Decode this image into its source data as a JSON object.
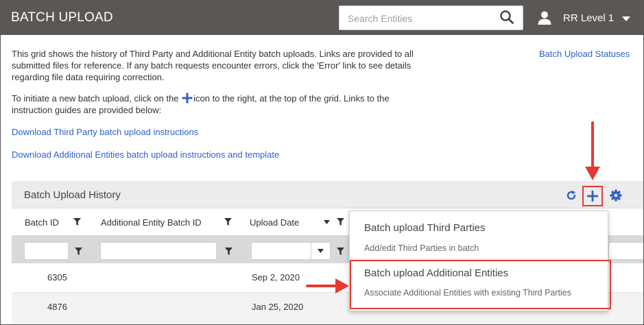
{
  "header": {
    "title": "BATCH UPLOAD",
    "search_placeholder": "Search Entities",
    "user_name": "RR Level 1"
  },
  "intro": {
    "paragraph1": "This grid shows the history of Third Party and Additional Entity batch uploads. Links are provided to all submitted files for reference. If any batch requests encounter errors, click the 'Error' link to see details regarding file data requiring correction.",
    "paragraph2_before": "To initiate a new batch upload, click on the",
    "paragraph2_after": "icon to the right, at the top of the grid. Links to the instruction guides are provided below:"
  },
  "links": {
    "statuses": "Batch Upload Statuses",
    "third_party_instructions": "Download Third Party batch upload instructions",
    "additional_entities_instructions": "Download Additional Entities batch upload instructions and template"
  },
  "grid": {
    "title": "Batch Upload History",
    "columns": [
      {
        "label": "Batch ID"
      },
      {
        "label": "Additional Entity Batch ID"
      },
      {
        "label": "Upload Date"
      }
    ],
    "rows": [
      {
        "batch_id": "6305",
        "ae_batch_id": "",
        "upload_date": "Sep 2, 2020"
      },
      {
        "batch_id": "4876",
        "ae_batch_id": "",
        "upload_date": "Jan 25, 2020"
      }
    ]
  },
  "dropdown": {
    "items": [
      {
        "title": "Batch upload Third Parties",
        "subtitle": "Add/edit Third Parties in batch"
      },
      {
        "title": "Batch upload Additional Entities",
        "subtitle": "Associate Additional Entities with existing Third Parties"
      }
    ]
  },
  "colors": {
    "header_bg": "#5b5754",
    "link": "#2f62c4",
    "accent_blue": "#2f62c4",
    "annotation_red": "#e53935",
    "grid_header_bg": "#ececec",
    "filter_row_bg": "#d9d9d9"
  },
  "icons": {
    "search": "search-icon",
    "user": "user-icon",
    "caret": "chevron-down-icon",
    "add": "plus-icon",
    "refresh": "refresh-icon",
    "settings": "gear-icon",
    "filter": "funnel-icon",
    "sort": "sort-down-icon"
  }
}
